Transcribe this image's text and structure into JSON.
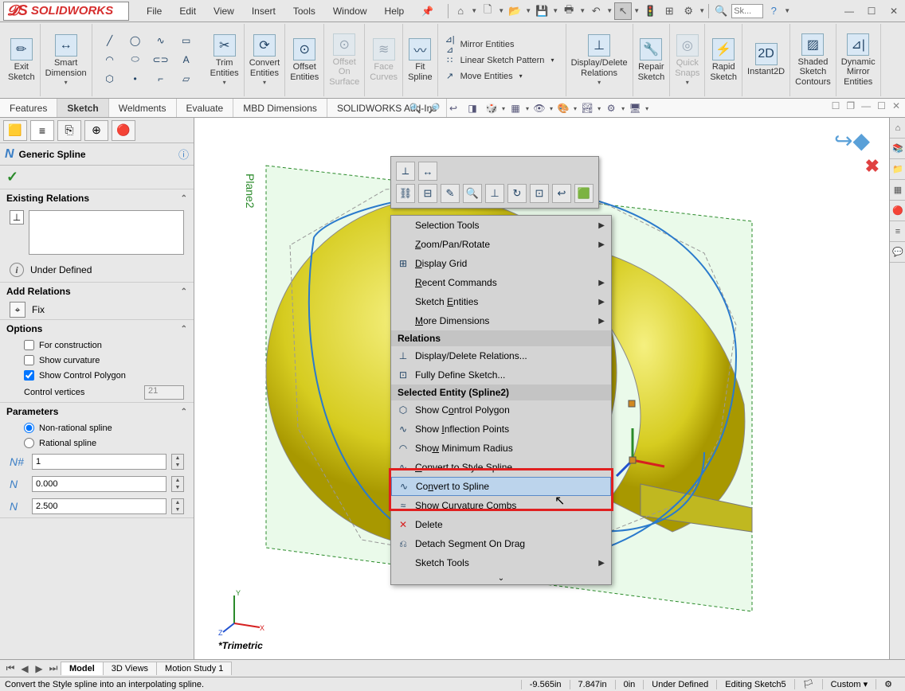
{
  "app_name": "SOLIDWORKS",
  "menubar": [
    "File",
    "Edit",
    "View",
    "Insert",
    "Tools",
    "Window",
    "Help"
  ],
  "title_search_placeholder": "Sk...",
  "ribbon": {
    "exit_sketch": "Exit\nSketch",
    "smart_dimension": "Smart\nDimension",
    "trim": "Trim\nEntities",
    "convert": "Convert\nEntities",
    "offset": "Offset\nEntities",
    "offset_surface": "Offset\nOn\nSurface",
    "face_curves": "Face\nCurves",
    "fit_spline": "Fit\nSpline",
    "mirror": "Mirror Entities",
    "linear_pattern": "Linear Sketch Pattern",
    "move": "Move Entities",
    "display_delete": "Display/Delete\nRelations",
    "repair": "Repair\nSketch",
    "quick_snaps": "Quick\nSnaps",
    "rapid": "Rapid\nSketch",
    "instant2d": "Instant2D",
    "shaded": "Shaded\nSketch\nContours",
    "dyn_mirror": "Dynamic\nMirror\nEntities"
  },
  "tabs": [
    "Features",
    "Sketch",
    "Weldments",
    "Evaluate",
    "MBD Dimensions",
    "SOLIDWORKS Add-Ins"
  ],
  "active_tab": "Sketch",
  "pm": {
    "title": "Generic Spline",
    "sections": {
      "existing_relations": "Existing Relations",
      "under_defined": "Under Defined",
      "add_relations": "Add Relations",
      "fix": "Fix",
      "options": "Options",
      "for_construction": "For construction",
      "show_curvature": "Show curvature",
      "show_control_polygon": "Show Control Polygon",
      "control_vertices": "Control vertices",
      "control_vertices_val": "21",
      "parameters": "Parameters",
      "non_rational": "Non-rational spline",
      "rational": "Rational spline",
      "p1": "1",
      "p2": "0.000",
      "p3": "2.500"
    }
  },
  "plane_label": "Plane2",
  "trimetric": "*Trimetric",
  "context_menu": {
    "selection_tools": "Selection Tools",
    "zoom_pan": "Zoom/Pan/Rotate",
    "display_grid": "Display Grid",
    "recent": "Recent Commands",
    "sketch_entities": "Sketch Entities",
    "more_dimensions": "More Dimensions",
    "relations_head": "Relations",
    "display_delete_rel": "Display/Delete Relations...",
    "fully_define": "Fully Define Sketch...",
    "selected_head": "Selected Entity (Spline2)",
    "show_control_polygon": "Show Control Polygon",
    "show_inflection": "Show Inflection Points",
    "show_min_radius": "Show Minimum Radius",
    "convert_style": "Convert to Style Spline",
    "convert_spline": "Convert to Spline",
    "show_combs": "Show Curvature Combs",
    "delete": "Delete",
    "detach": "Detach Segment On Drag",
    "sketch_tools": "Sketch Tools"
  },
  "bottom_tabs": [
    "Model",
    "3D Views",
    "Motion Study 1"
  ],
  "status": {
    "message": "Convert the Style spline into an interpolating spline.",
    "x": "-9.565in",
    "y": "7.847in",
    "z": "0in",
    "state": "Under Defined",
    "editing": "Editing Sketch5",
    "units": "Custom"
  }
}
